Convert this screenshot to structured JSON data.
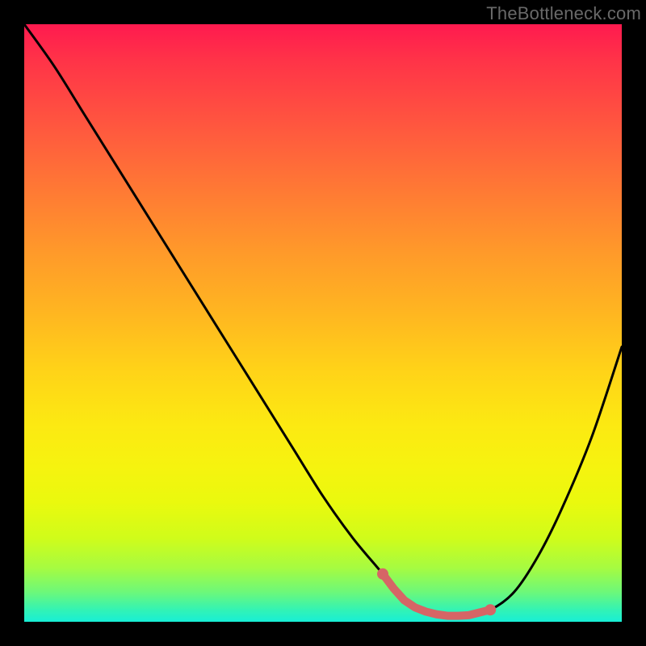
{
  "watermark": "TheBottleneck.com",
  "colors": {
    "frame": "#000000",
    "curve": "#000000",
    "marker": "#d66566",
    "gradient_top": "#ff1a4f",
    "gradient_bottom": "#17eed6"
  },
  "chart_data": {
    "type": "line",
    "title": "",
    "xlabel": "",
    "ylabel": "",
    "xlim": [
      0,
      100
    ],
    "ylim": [
      0,
      100
    ],
    "grid": false,
    "legend": false,
    "series": [
      {
        "name": "bottleneck-curve",
        "x": [
          0,
          5,
          10,
          15,
          20,
          25,
          30,
          35,
          40,
          45,
          50,
          55,
          60,
          63,
          66,
          70,
          74,
          78,
          82,
          86,
          90,
          95,
          100
        ],
        "y": [
          100,
          93,
          85,
          77,
          69,
          61,
          53,
          45,
          37,
          29,
          21,
          14,
          8,
          4,
          2,
          1,
          1,
          2,
          5,
          11,
          19,
          31,
          46
        ]
      }
    ],
    "annotations": [
      {
        "name": "optimum-band",
        "x_range": [
          60,
          78
        ],
        "y": 1
      }
    ]
  }
}
